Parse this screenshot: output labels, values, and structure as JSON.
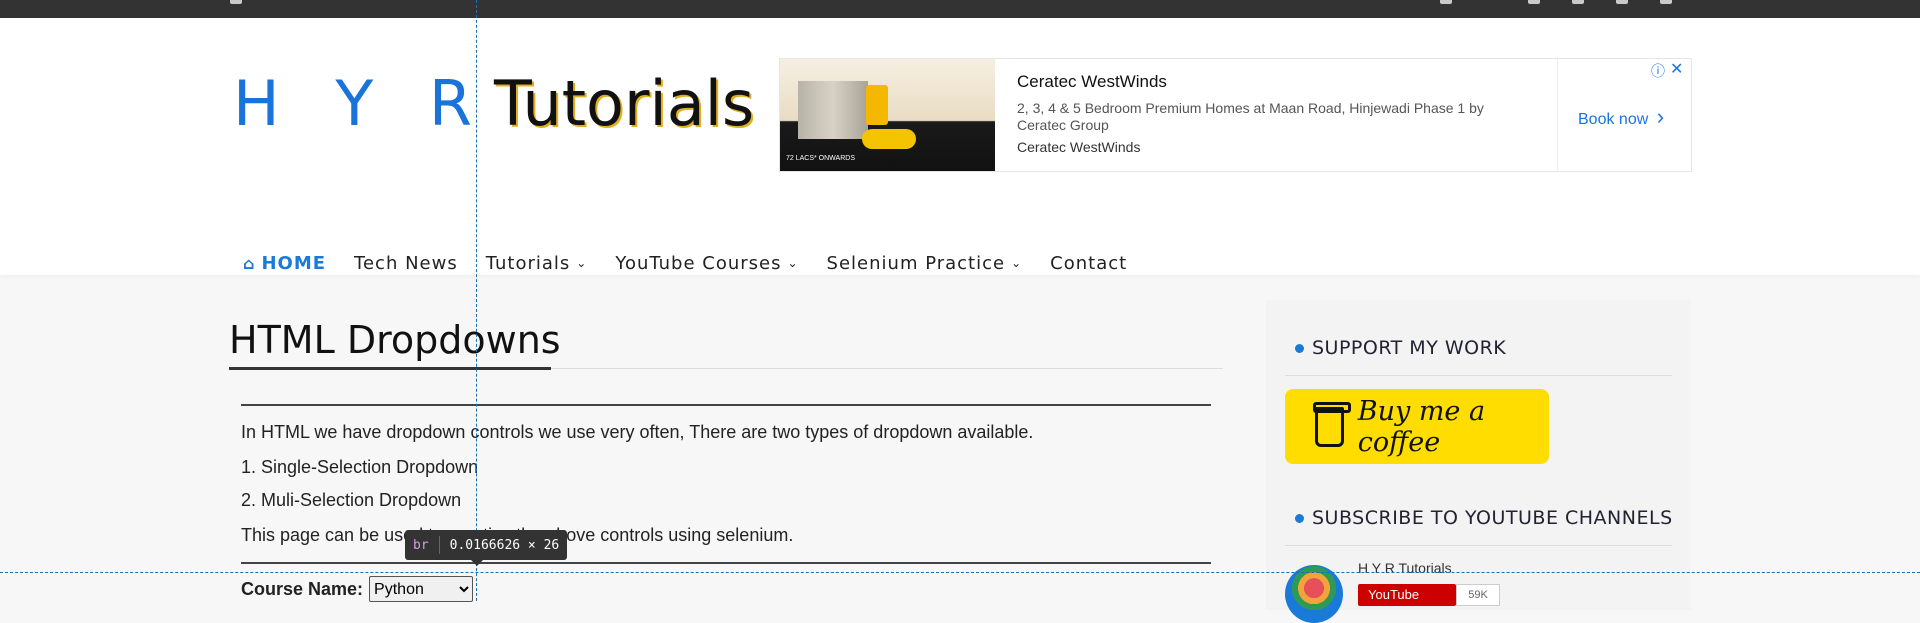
{
  "site": {
    "logo_part1": "H Y R",
    "logo_part2": "Tutorials"
  },
  "ad": {
    "title": "Ceratec WestWinds",
    "description": "2, 3, 4 & 5 Bedroom Premium Homes at Maan Road, Hinjewadi Phase 1 by Ceratec Group",
    "brand": "Ceratec WestWinds",
    "cta": "Book now",
    "cta_icon": "›",
    "info_icon": "ⓘ",
    "close_icon": "✕",
    "image_caption": "72 LACS* ONWARDS"
  },
  "nav": {
    "home_icon": "⌂",
    "items": [
      {
        "label": "HOME"
      },
      {
        "label": "Tech News"
      },
      {
        "label": "Tutorials"
      },
      {
        "label": "YouTube Courses"
      },
      {
        "label": "Selenium Practice"
      },
      {
        "label": "Contact"
      }
    ],
    "chevron": "⌄"
  },
  "page": {
    "title": "HTML Dropdowns",
    "intro": "In HTML we have dropdown controls we use very often, There are two types of dropdown available.",
    "item1": "1. Single-Selection Dropdown",
    "item2": "2. Muli-Selection Dropdown",
    "note": "This page can be used to practice the above controls using selenium.",
    "course_label": "Course Name:",
    "course_selected": "Python"
  },
  "sidebar": {
    "support_title": "SUPPORT MY WORK",
    "bmc_label": "Buy me a coffee",
    "subscribe_title": "SUBSCRIBE TO YOUTUBE CHANNELS",
    "channel_name": "H Y R Tutorials",
    "youtube_label": "YouTube",
    "subscriber_count": "59K"
  },
  "devtools": {
    "tooltip_tag": "br",
    "tooltip_size": "0.0166626 × 26"
  },
  "colors": {
    "accent": "#1a7ad9",
    "topbar": "#333333",
    "bmc_yellow": "#ffdd00"
  }
}
